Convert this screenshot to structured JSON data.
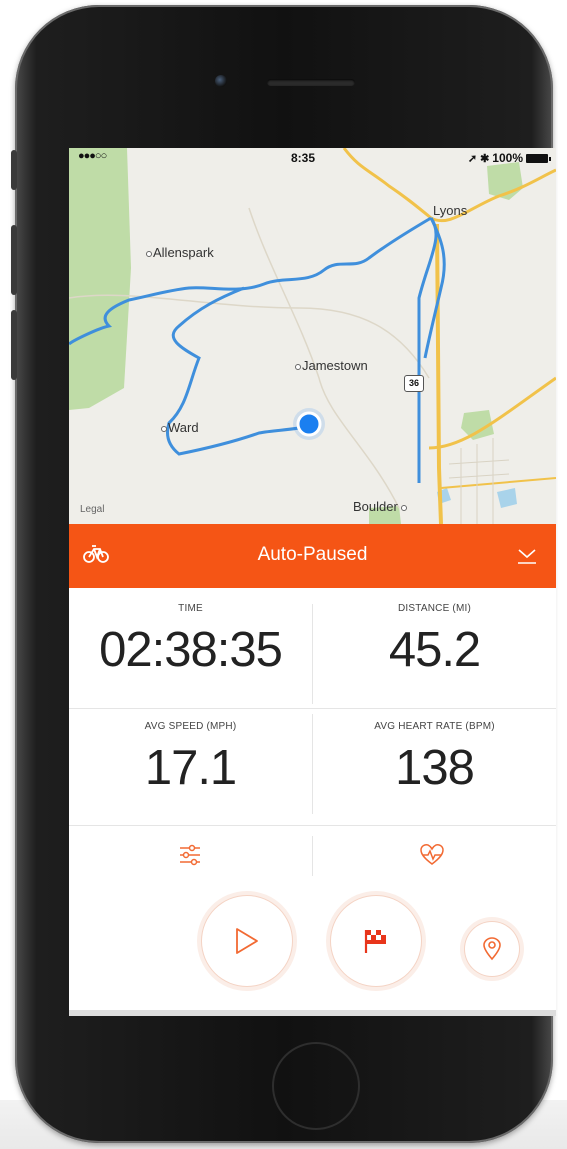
{
  "status_bar": {
    "carrier": "●●●○○",
    "time": "8:35",
    "battery_text": "100%"
  },
  "map": {
    "places": [
      "Lyons",
      "Allenspark",
      "Jamestown",
      "Ward",
      "Boulder"
    ],
    "highway": "36",
    "legal": "Legal",
    "route_color": "#3f8fdc",
    "location_dot_color": "#1a7ff0",
    "road_color": "#f1c24a",
    "park_color": "#bfdca7"
  },
  "activity_bar": {
    "status": "Auto-Paused",
    "color": "#f55515",
    "left_icon": "bicycle-icon",
    "right_icon": "chevron-down-icon"
  },
  "stats": [
    {
      "label": "TIME",
      "value": "02:38:35"
    },
    {
      "label": "DISTANCE (MI)",
      "value": "45.2"
    },
    {
      "label": "AVG SPEED (MPH)",
      "value": "17.1"
    },
    {
      "label": "AVG HEART RATE (BPM)",
      "value": "138"
    }
  ],
  "tools": {
    "left_icon": "sliders-icon",
    "right_icon": "heart-rate-icon"
  },
  "controls": {
    "resume_icon": "play-icon",
    "finish_icon": "checkered-flag-icon",
    "location_icon": "map-pin-icon"
  }
}
